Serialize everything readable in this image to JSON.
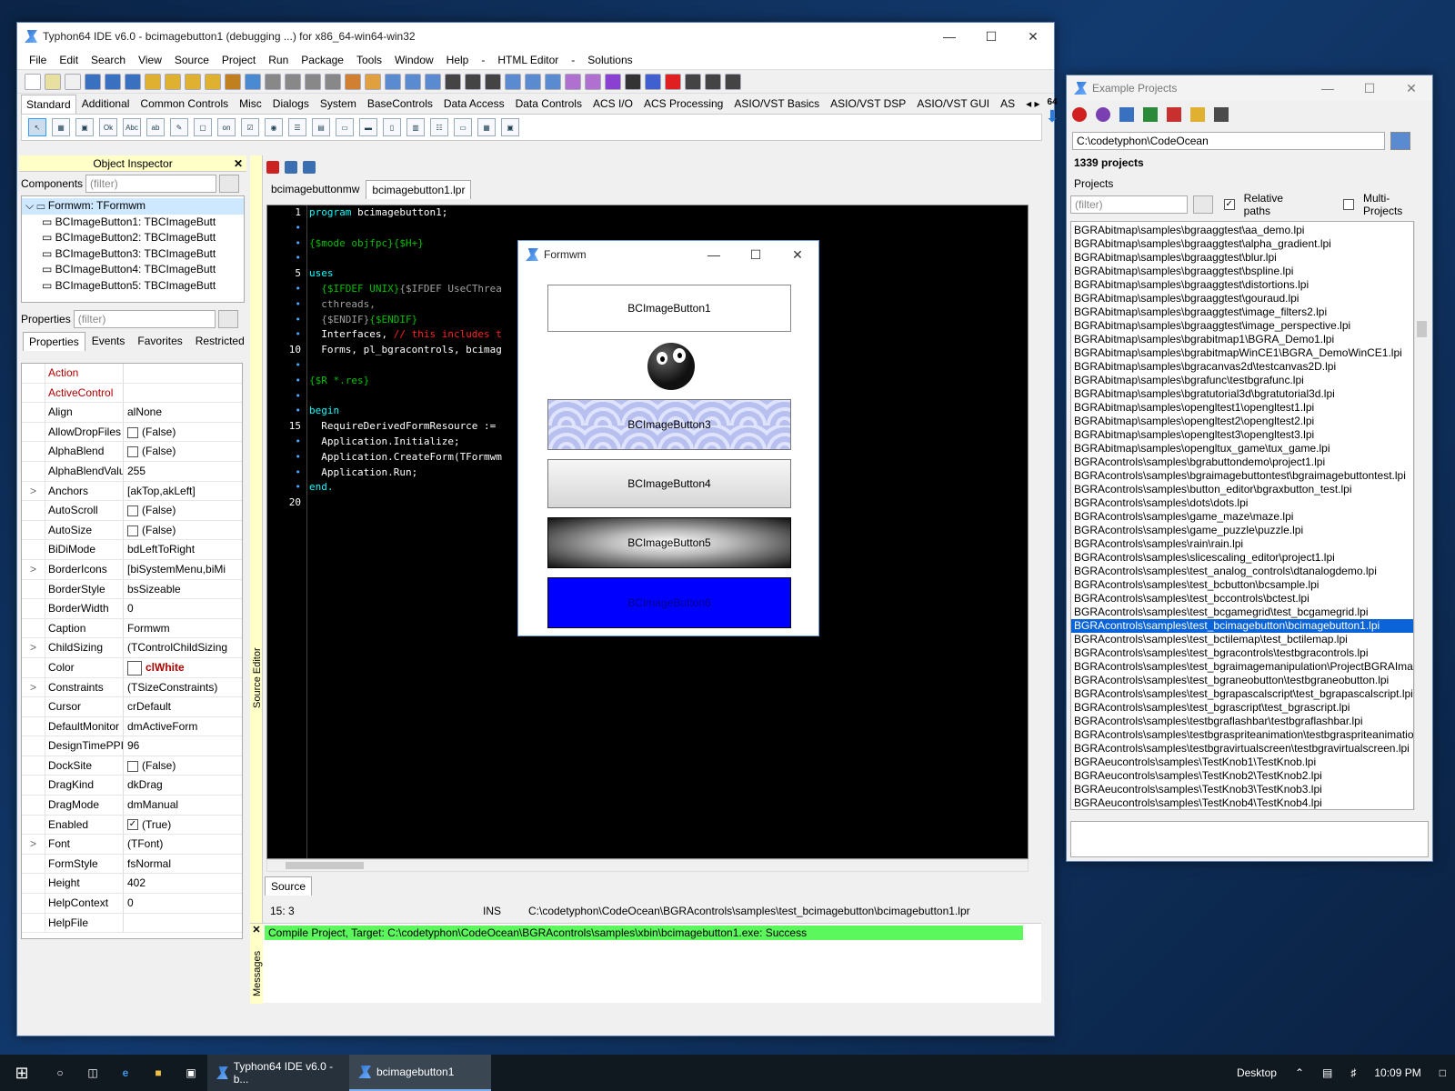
{
  "ide": {
    "title": "Typhon64 IDE v6.0 - bcimagebutton1 (debugging ...) for x86_64-win64-win32",
    "menu": [
      "File",
      "Edit",
      "Search",
      "View",
      "Source",
      "Project",
      "Run",
      "Package",
      "Tools",
      "Window",
      "Help",
      "-",
      "HTML Editor",
      "-",
      "Solutions"
    ],
    "palette_tabs": [
      "Standard",
      "Additional",
      "Common Controls",
      "Misc",
      "Dialogs",
      "System",
      "BaseControls",
      "Data Access",
      "Data Controls",
      "ACS I/O",
      "ACS Processing",
      "ASIO/VST Basics",
      "ASIO/VST DSP",
      "ASIO/VST GUI",
      "AS"
    ],
    "palette_badge": "64"
  },
  "inspector": {
    "title": "Object Inspector",
    "components_label": "Components",
    "filter_placeholder": "(filter)",
    "tree": [
      "Formwm: TFormwm",
      "BCImageButton1: TBCImageButt",
      "BCImageButton2: TBCImageButt",
      "BCImageButton3: TBCImageButt",
      "BCImageButton4: TBCImageButt",
      "BCImageButton5: TBCImageButt"
    ],
    "properties_label": "Properties",
    "tabs": [
      "Properties",
      "Events",
      "Favorites",
      "Restricted"
    ],
    "props": [
      {
        "g": "",
        "n": "Action",
        "v": "",
        "red": true
      },
      {
        "g": "",
        "n": "ActiveControl",
        "v": "",
        "red": true
      },
      {
        "g": "",
        "n": "Align",
        "v": "alNone"
      },
      {
        "g": "",
        "n": "AllowDropFiles",
        "v": "(False)",
        "cb": ""
      },
      {
        "g": "",
        "n": "AlphaBlend",
        "v": "(False)",
        "cb": ""
      },
      {
        "g": "",
        "n": "AlphaBlendValu",
        "v": "255"
      },
      {
        "g": ">",
        "n": "Anchors",
        "v": "[akTop,akLeft]"
      },
      {
        "g": "",
        "n": "AutoScroll",
        "v": "(False)",
        "cb": ""
      },
      {
        "g": "",
        "n": "AutoSize",
        "v": "(False)",
        "cb": ""
      },
      {
        "g": "",
        "n": "BiDiMode",
        "v": "bdLeftToRight"
      },
      {
        "g": ">",
        "n": "BorderIcons",
        "v": "[biSystemMenu,biMi"
      },
      {
        "g": "",
        "n": "BorderStyle",
        "v": "bsSizeable"
      },
      {
        "g": "",
        "n": "BorderWidth",
        "v": "0"
      },
      {
        "g": "",
        "n": "Caption",
        "v": "Formwm"
      },
      {
        "g": ">",
        "n": "ChildSizing",
        "v": "(TControlChildSizing"
      },
      {
        "g": "",
        "n": "Color",
        "v": "clWhite",
        "color": true
      },
      {
        "g": ">",
        "n": "Constraints",
        "v": "(TSizeConstraints)"
      },
      {
        "g": "",
        "n": "Cursor",
        "v": "crDefault"
      },
      {
        "g": "",
        "n": "DefaultMonitor",
        "v": "dmActiveForm"
      },
      {
        "g": "",
        "n": "DesignTimePPI",
        "v": "96"
      },
      {
        "g": "",
        "n": "DockSite",
        "v": "(False)",
        "cb": ""
      },
      {
        "g": "",
        "n": "DragKind",
        "v": "dkDrag"
      },
      {
        "g": "",
        "n": "DragMode",
        "v": "dmManual"
      },
      {
        "g": "",
        "n": "Enabled",
        "v": "(True)",
        "cb": "✓"
      },
      {
        "g": ">",
        "n": "Font",
        "v": "(TFont)"
      },
      {
        "g": "",
        "n": "FormStyle",
        "v": "fsNormal"
      },
      {
        "g": "",
        "n": "Height",
        "v": "402"
      },
      {
        "g": "",
        "n": "HelpContext",
        "v": "0"
      },
      {
        "g": "",
        "n": "HelpFile",
        "v": ""
      }
    ]
  },
  "source": {
    "tabs": [
      "bcimagebuttonmw",
      "bcimagebutton1.lpr"
    ],
    "side_label": "Source Editor",
    "bottom_tab": "Source",
    "gutter": [
      "1",
      "•",
      "•",
      "•",
      "5",
      "•",
      "•",
      "•",
      "•",
      "10",
      "•",
      "•",
      "•",
      "•",
      "15",
      "•",
      "•",
      "•",
      "•",
      "20"
    ],
    "lines": [
      [
        {
          "t": "program ",
          "c": "kw"
        },
        {
          "t": "bcimagebutton1;",
          "c": "tx"
        }
      ],
      [],
      [
        {
          "t": "{$mode objfpc}{$H+}",
          "c": "cm"
        }
      ],
      [],
      [
        {
          "t": "uses",
          "c": "kw"
        }
      ],
      [
        {
          "t": "  {$IFDEF UNIX}",
          "c": "cm"
        },
        {
          "t": "{$IFDEF UseCThrea",
          "c": "dim"
        }
      ],
      [
        {
          "t": "  cthreads,",
          "c": "dim"
        }
      ],
      [
        {
          "t": "  {$ENDIF}",
          "c": "dim"
        },
        {
          "t": "{$ENDIF}",
          "c": "cm"
        }
      ],
      [
        {
          "t": "  Interfaces, ",
          "c": "tx"
        },
        {
          "t": "// this includes t",
          "c": "red"
        }
      ],
      [
        {
          "t": "  Forms, pl_bgracontrols, bcimag",
          "c": "tx"
        }
      ],
      [],
      [
        {
          "t": "{$R *.res}",
          "c": "cm"
        }
      ],
      [],
      [
        {
          "t": "begin",
          "c": "kw"
        }
      ],
      [
        {
          "t": "  RequireDerivedFormResource := ",
          "c": "tx"
        }
      ],
      [
        {
          "t": "  Application.Initialize;",
          "c": "tx"
        }
      ],
      [
        {
          "t": "  Application.CreateForm(TFormwm",
          "c": "tx"
        }
      ],
      [
        {
          "t": "  Application.Run;",
          "c": "tx"
        }
      ],
      [
        {
          "t": "end.",
          "c": "kw"
        }
      ],
      []
    ],
    "status_pos": "15:  3",
    "status_mode": "INS",
    "status_path": "C:\\codetyphon\\CodeOcean\\BGRAcontrols\\samples\\test_bcimagebutton\\bcimagebutton1.lpr"
  },
  "messages": {
    "label": "Messages",
    "text": "Compile Project, Target: C:\\codetyphon\\CodeOcean\\BGRAcontrols\\samples\\xbin\\bcimagebutton1.exe: Success"
  },
  "form": {
    "title": "Formwm",
    "buttons": [
      "BCImageButton1",
      "BCImageButton3",
      "BCImageButton4",
      "BCImageButton5",
      "BCImageButton6"
    ]
  },
  "examples": {
    "title": "Example Projects",
    "path": "C:\\codetyphon\\CodeOcean",
    "count": "1339 projects",
    "projects_label": "Projects",
    "filter_placeholder": "(filter)",
    "relative_paths": "Relative paths",
    "multi_projects": "Multi-Projects",
    "items": [
      "BGRAbitmap\\samples\\bgraaggtest\\aa_demo.lpi",
      "BGRAbitmap\\samples\\bgraaggtest\\alpha_gradient.lpi",
      "BGRAbitmap\\samples\\bgraaggtest\\blur.lpi",
      "BGRAbitmap\\samples\\bgraaggtest\\bspline.lpi",
      "BGRAbitmap\\samples\\bgraaggtest\\distortions.lpi",
      "BGRAbitmap\\samples\\bgraaggtest\\gouraud.lpi",
      "BGRAbitmap\\samples\\bgraaggtest\\image_filters2.lpi",
      "BGRAbitmap\\samples\\bgraaggtest\\image_perspective.lpi",
      "BGRAbitmap\\samples\\bgrabitmap1\\BGRA_Demo1.lpi",
      "BGRAbitmap\\samples\\bgrabitmapWinCE1\\BGRA_DemoWinCE1.lpi",
      "BGRAbitmap\\samples\\bgracanvas2d\\testcanvas2D.lpi",
      "BGRAbitmap\\samples\\bgrafunc\\testbgrafunc.lpi",
      "BGRAbitmap\\samples\\bgratutorial3d\\bgratutorial3d.lpi",
      "BGRAbitmap\\samples\\opengltest1\\opengltest1.lpi",
      "BGRAbitmap\\samples\\opengltest2\\opengltest2.lpi",
      "BGRAbitmap\\samples\\opengltest3\\opengltest3.lpi",
      "BGRAbitmap\\samples\\opengltux_game\\tux_game.lpi",
      "BGRAcontrols\\samples\\bgrabuttondemo\\project1.lpi",
      "BGRAcontrols\\samples\\bgraimagebuttontest\\bgraimagebuttontest.lpi",
      "BGRAcontrols\\samples\\button_editor\\bgraxbutton_test.lpi",
      "BGRAcontrols\\samples\\dots\\dots.lpi",
      "BGRAcontrols\\samples\\game_maze\\maze.lpi",
      "BGRAcontrols\\samples\\game_puzzle\\puzzle.lpi",
      "BGRAcontrols\\samples\\rain\\rain.lpi",
      "BGRAcontrols\\samples\\slicescaling_editor\\project1.lpi",
      "BGRAcontrols\\samples\\test_analog_controls\\dtanalogdemo.lpi",
      "BGRAcontrols\\samples\\test_bcbutton\\bcsample.lpi",
      "BGRAcontrols\\samples\\test_bccontrols\\bctest.lpi",
      "BGRAcontrols\\samples\\test_bcgamegrid\\test_bcgamegrid.lpi",
      "BGRAcontrols\\samples\\test_bcimagebutton\\bcimagebutton1.lpi",
      "BGRAcontrols\\samples\\test_bctilemap\\test_bctilemap.lpi",
      "BGRAcontrols\\samples\\test_bgracontrols\\testbgracontrols.lpi",
      "BGRAcontrols\\samples\\test_bgraimagemanipulation\\ProjectBGRAImag",
      "BGRAcontrols\\samples\\test_bgraneobutton\\testbgraneobutton.lpi",
      "BGRAcontrols\\samples\\test_bgrapascalscript\\test_bgrapascalscript.lpi",
      "BGRAcontrols\\samples\\test_bgrascript\\test_bgrascript.lpi",
      "BGRAcontrols\\samples\\testbgraflashbar\\testbgraflashbar.lpi",
      "BGRAcontrols\\samples\\testbgraspriteanimation\\testbgraspriteanimation",
      "BGRAcontrols\\samples\\testbgravirtualscreen\\testbgravirtualscreen.lpi",
      "BGRAeucontrols\\samples\\TestKnob1\\TestKnob.lpi",
      "BGRAeucontrols\\samples\\TestKnob2\\TestKnob2.lpi",
      "BGRAeucontrols\\samples\\TestKnob3\\TestKnob3.lpi",
      "BGRAeucontrols\\samples\\TestKnob4\\TestKnob4.lpi"
    ],
    "selected_index": 29
  },
  "taskbar": {
    "items": [
      "Typhon64 IDE v6.0 - b...",
      "bcimagebutton1"
    ],
    "desktop": "Desktop",
    "time": "10:09 PM"
  }
}
